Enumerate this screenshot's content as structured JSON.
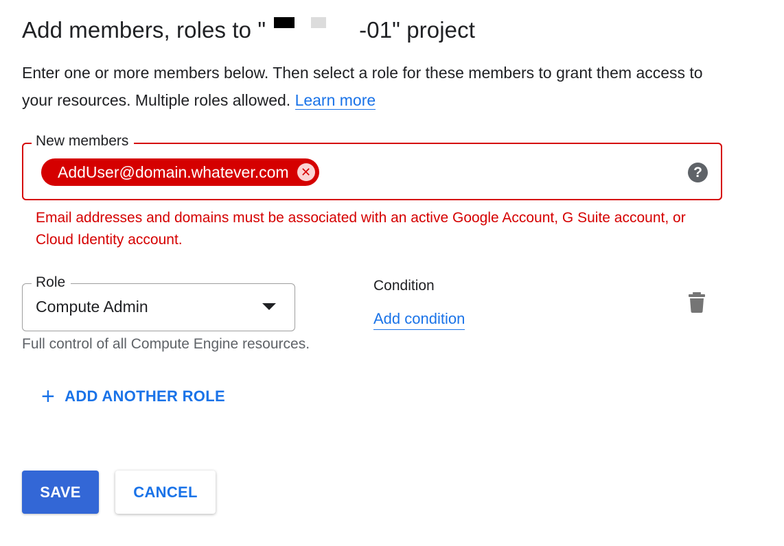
{
  "dialog": {
    "title_prefix": "Add members, roles to \"",
    "title_suffix": "-01\" project",
    "intro_text": "Enter one or more members below. Then select a role for these members to grant them access to your resources. Multiple roles allowed.",
    "learn_more": "Learn more"
  },
  "members": {
    "label": "New members",
    "chips": [
      "AddUser@domain.whatever.com"
    ],
    "help_icon": "?",
    "error": "Email addresses and domains must be associated with an active Google Account, G Suite account, or Cloud Identity account."
  },
  "role": {
    "label": "Role",
    "value": "Compute Admin",
    "description": "Full control of all Compute Engine resources."
  },
  "condition": {
    "label": "Condition",
    "add_link": "Add condition"
  },
  "add_role": {
    "icon": "+",
    "label": "ADD ANOTHER ROLE"
  },
  "actions": {
    "save": "SAVE",
    "cancel": "CANCEL"
  },
  "colors": {
    "error": "#d50000",
    "accent": "#1a73e8",
    "primary_button": "#3367d6"
  }
}
